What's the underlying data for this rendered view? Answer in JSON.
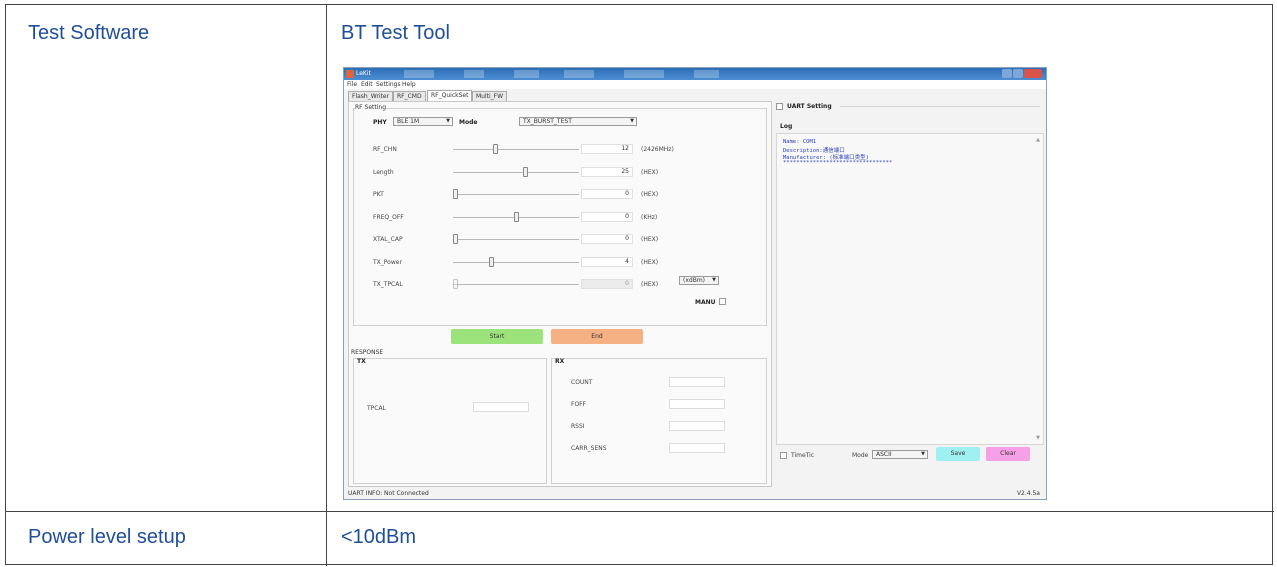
{
  "table": {
    "row1_label": "Test Software",
    "row1_value": "BT Test Tool",
    "row2_label": "Power level setup",
    "row2_value": "<10dBm"
  },
  "app": {
    "title": "LeKit",
    "menu": [
      "File",
      "Edit",
      "Settings",
      "Help"
    ],
    "tabs": [
      "Flash_Writer",
      "RF_CMD",
      "RF_QuickSet",
      "Multi_FW"
    ],
    "active_tab": "RF_QuickSet",
    "rf_setting_label": "RF Setting",
    "phy_label": "PHY",
    "phy_value": "BLE 1M",
    "mode_label": "Mode",
    "mode_value": "TX_BURST_TEST",
    "params": [
      {
        "name": "RF_CHN",
        "value": "12",
        "unit": "(2426MHz)",
        "slider_fraction": 0.33
      },
      {
        "name": "Length",
        "value": "25",
        "unit": "(HEX)",
        "slider_fraction": 0.58
      },
      {
        "name": "PKT",
        "value": "0",
        "unit": "(HEX)",
        "slider_fraction": 0.0
      },
      {
        "name": "FREQ_OFF",
        "value": "0",
        "unit": "(KHz)",
        "slider_fraction": 0.5
      },
      {
        "name": "XTAL_CAP",
        "value": "0",
        "unit": "(HEX)",
        "slider_fraction": 0.0
      },
      {
        "name": "TX_Power",
        "value": "4",
        "unit": "(HEX)",
        "slider_fraction": 0.3
      },
      {
        "name": "TX_TPCAL",
        "value": "0",
        "unit": "(HEX)",
        "slider_fraction": 0.0
      }
    ],
    "tx_power_unit_combo": "(xdBm)",
    "manu_label": "MANU",
    "start_label": "Start",
    "end_label": "End",
    "response_label": "RESPONSE",
    "tx_label": "TX",
    "tpcal_label": "TPCAL",
    "rx_label": "RX",
    "rx_fields": [
      "COUNT",
      "FOFF",
      "RSSI",
      "CARR_SENS"
    ],
    "uart_setting_label": "UART Setting",
    "log_label": "Log",
    "log_lines": [
      "Name: COM1",
      "Description:通信端口",
      "Manufacturer: (标准端口类型)",
      "*********************************"
    ],
    "timetic_label": "TimeTic",
    "mode_label2": "Mode",
    "mode_value2": "ASCII",
    "save_label": "Save",
    "clear_label": "Clear",
    "status_text": "UART INFO: Not Connected",
    "version": "V2.4.5a"
  },
  "colors": {
    "doc_text": "#1f4e9b",
    "start_button": "#9be37a",
    "end_button": "#f5b183",
    "save_button": "#9ff0f0",
    "clear_button": "#f6a0e8"
  }
}
